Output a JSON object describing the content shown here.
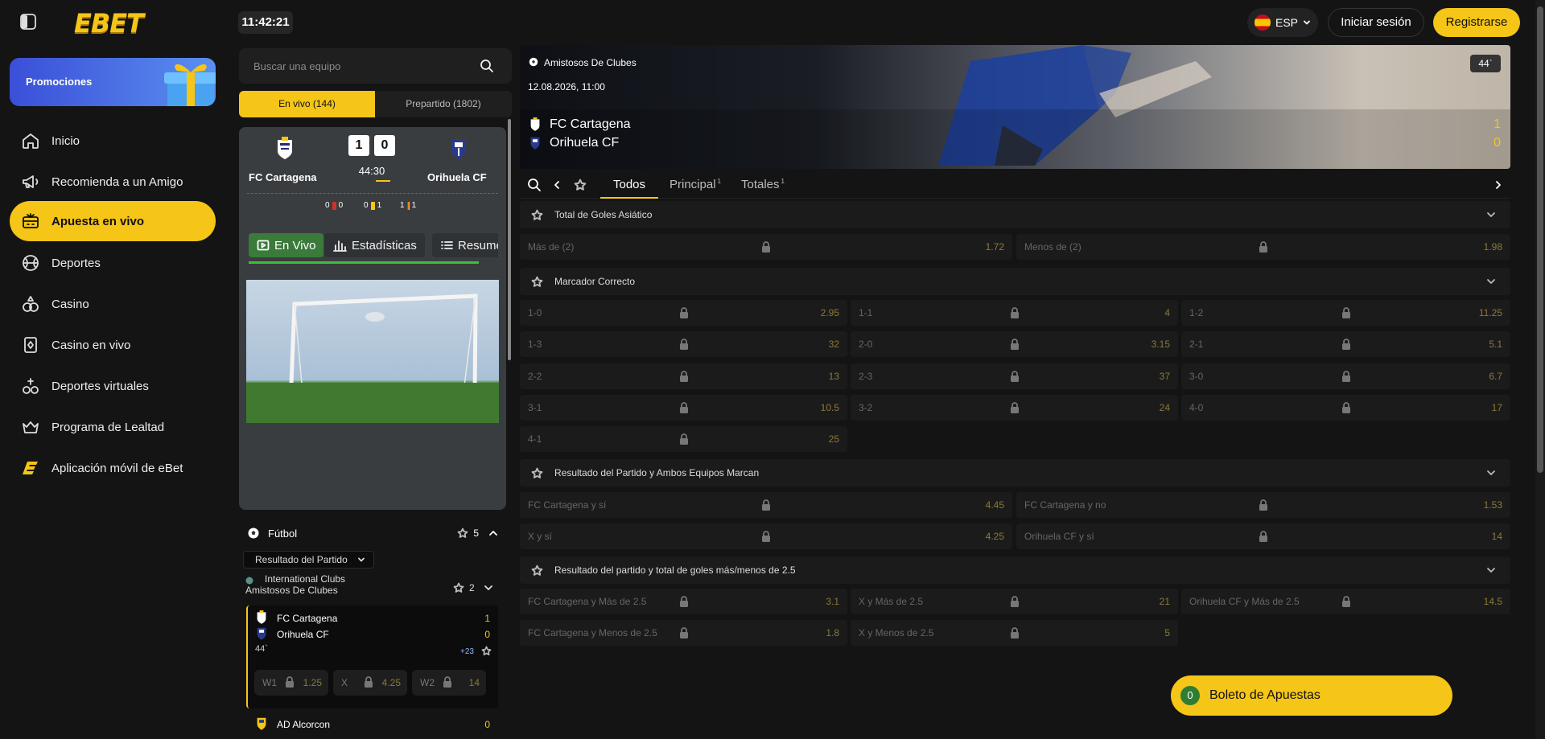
{
  "header": {
    "logo": "EBET",
    "clock": "11:42:21",
    "language": "ESP",
    "login_label": "Iniciar sesión",
    "register_label": "Registrarse"
  },
  "sidebar": {
    "promo_label": "Promociones",
    "items": [
      {
        "label": "Inicio",
        "icon": "home-icon"
      },
      {
        "label": "Recomienda a un Amigo",
        "icon": "megaphone-icon"
      },
      {
        "label": "Apuesta en vivo",
        "icon": "live-betting-icon",
        "active": true
      },
      {
        "label": "Deportes",
        "icon": "ball-icon"
      },
      {
        "label": "Casino",
        "icon": "casino-icon"
      },
      {
        "label": "Casino en vivo",
        "icon": "live-casino-icon"
      },
      {
        "label": "Deportes virtuales",
        "icon": "virtual-sports-icon"
      },
      {
        "label": "Programa de Lealtad",
        "icon": "crown-icon"
      },
      {
        "label": "Aplicación móvil de eBet",
        "icon": "ebet-app-icon"
      }
    ]
  },
  "search": {
    "placeholder": "Buscar una equipo"
  },
  "tabs": {
    "live": "En vivo",
    "live_count": "(144)",
    "prematch": "Prepartido",
    "prematch_count": "(1802)"
  },
  "match_card": {
    "home": "FC Cartagena",
    "away": "Orihuela CF",
    "home_score": "1",
    "away_score": "0",
    "time": "44:30",
    "stats": [
      "0",
      "0",
      "0",
      "1",
      "1",
      "1"
    ],
    "tab_live": "En Vivo",
    "tab_stats": "Estadísticas",
    "tab_summary": "Resumen"
  },
  "sport_list": {
    "sport": "Fútbol",
    "sport_count": "5",
    "market": "Resultado del Partido",
    "league_1": "International Clubs",
    "league_2": "Amistosos De Clubes",
    "league_count": "2",
    "event": {
      "home": "FC Cartagena",
      "away": "Orihuela CF",
      "home_score": "1",
      "away_score": "0",
      "minute": "44`",
      "more": "+23",
      "odds": [
        {
          "label": "W1",
          "value": "1.25"
        },
        {
          "label": "X",
          "value": "4.25"
        },
        {
          "label": "W2",
          "value": "14"
        }
      ]
    },
    "next_event": {
      "team": "AD Alcorcon",
      "score": "0"
    }
  },
  "banner": {
    "league": "Amistosos De Clubes",
    "datetime": "12.08.2026, 11:00",
    "home": "FC Cartagena",
    "away": "Orihuela CF",
    "home_score": "1",
    "away_score": "0",
    "minute": "44`"
  },
  "market_tabs": [
    {
      "label": "Todos",
      "count": ""
    },
    {
      "label": "Principal",
      "count": "1"
    },
    {
      "label": "Totales",
      "count": "1"
    }
  ],
  "markets": [
    {
      "title": "Total de Goles Asiático",
      "odds": [
        {
          "label": "Más de (2)",
          "value": "1.72"
        },
        {
          "label": "Menos de (2)",
          "value": "1.98"
        }
      ]
    },
    {
      "title": "Marcador Correcto",
      "odds": [
        {
          "label": "1-0",
          "value": "2.95"
        },
        {
          "label": "1-1",
          "value": "4"
        },
        {
          "label": "1-2",
          "value": "11.25"
        },
        {
          "label": "1-3",
          "value": "32"
        },
        {
          "label": "2-0",
          "value": "3.15"
        },
        {
          "label": "2-1",
          "value": "5.1"
        },
        {
          "label": "2-2",
          "value": "13"
        },
        {
          "label": "2-3",
          "value": "37"
        },
        {
          "label": "3-0",
          "value": "6.7"
        },
        {
          "label": "3-1",
          "value": "10.5"
        },
        {
          "label": "3-2",
          "value": "24"
        },
        {
          "label": "4-0",
          "value": "17"
        },
        {
          "label": "4-1",
          "value": "25"
        }
      ]
    },
    {
      "title": "Resultado del Partido y Ambos Equipos Marcan",
      "odds": [
        {
          "label": "FC Cartagena y sí",
          "value": "4.45"
        },
        {
          "label": "FC Cartagena y no",
          "value": "1.53"
        },
        {
          "label": "X y sí",
          "value": "4.25"
        },
        {
          "label": "Orihuela CF y sí",
          "value": "14"
        }
      ]
    },
    {
      "title": "Resultado del partido y total de goles más/menos de 2.5",
      "odds": [
        {
          "label": "FC Cartagena y Más de 2.5",
          "value": "3.1"
        },
        {
          "label": "X y Más de 2.5",
          "value": "21"
        },
        {
          "label": "Orihuela CF y Más de 2.5",
          "value": "14.5"
        },
        {
          "label": "FC Cartagena y Menos de 2.5",
          "value": "1.8"
        },
        {
          "label": "X y Menos de 2.5",
          "value": "5"
        }
      ]
    }
  ],
  "betslip": {
    "count": "0",
    "label": "Boleto de Apuestas"
  }
}
